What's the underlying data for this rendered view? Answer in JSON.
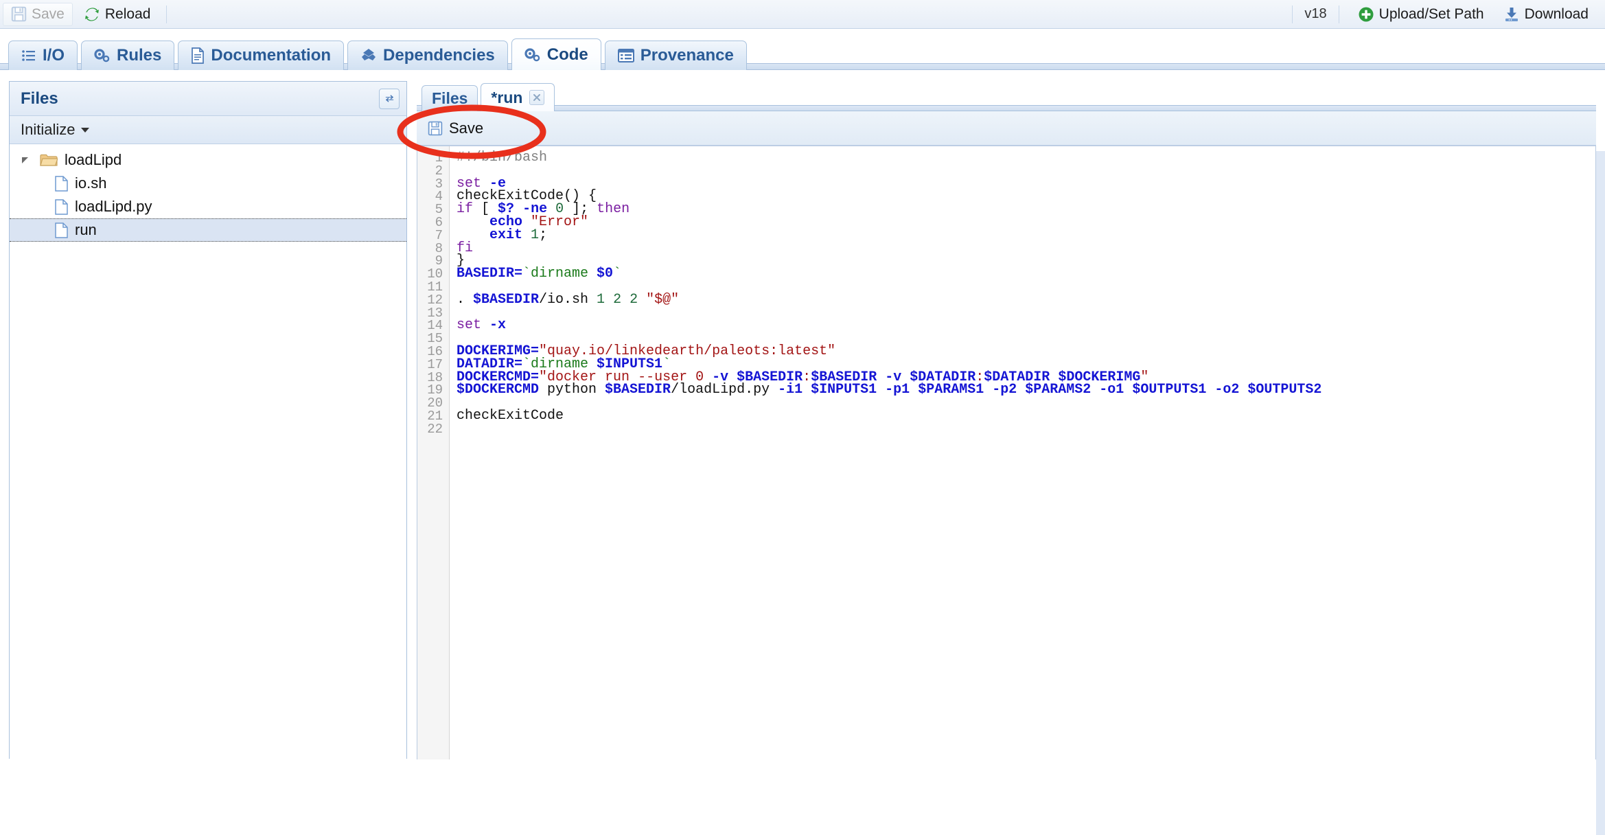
{
  "top_toolbar": {
    "save_label": "Save",
    "save_disabled": true,
    "reload_label": "Reload",
    "version_label": "v18",
    "upload_label": "Upload/Set Path",
    "download_label": "Download"
  },
  "main_tabs": [
    {
      "label": "I/O",
      "icon": "list-icon",
      "active": false
    },
    {
      "label": "Rules",
      "icon": "gears-icon",
      "active": false
    },
    {
      "label": "Documentation",
      "icon": "document-icon",
      "active": false
    },
    {
      "label": "Dependencies",
      "icon": "puzzle-icon",
      "active": false
    },
    {
      "label": "Code",
      "icon": "gears-icon",
      "active": true
    },
    {
      "label": "Provenance",
      "icon": "table-icon",
      "active": false
    }
  ],
  "files_panel": {
    "title": "Files",
    "refresh_icon": "refresh-icon",
    "initialize_label": "Initialize",
    "tree": [
      {
        "label": "loadLipd",
        "type": "folder",
        "level": 1,
        "expanded": true,
        "selected": false
      },
      {
        "label": "io.sh",
        "type": "file",
        "level": 2,
        "selected": false
      },
      {
        "label": "loadLipd.py",
        "type": "file",
        "level": 2,
        "selected": false
      },
      {
        "label": "run",
        "type": "file",
        "level": 2,
        "selected": true
      }
    ]
  },
  "editor": {
    "tabs": [
      {
        "label": "Files",
        "active": false,
        "closable": false
      },
      {
        "label": "*run",
        "active": true,
        "closable": true
      }
    ],
    "save_label": "Save",
    "first_line_number": 1,
    "last_line_number": 22,
    "lines": [
      {
        "n": 1,
        "tokens": [
          {
            "t": "#!/bin/bash",
            "c": "c"
          }
        ]
      },
      {
        "n": 2,
        "tokens": []
      },
      {
        "n": 3,
        "tokens": [
          {
            "t": "set",
            "c": "k"
          },
          {
            "t": " ",
            "c": "b"
          },
          {
            "t": "-e",
            "c": "v"
          }
        ]
      },
      {
        "n": 4,
        "tokens": [
          {
            "t": "checkExitCode() {",
            "c": "b"
          }
        ]
      },
      {
        "n": 5,
        "tokens": [
          {
            "t": "if",
            "c": "k"
          },
          {
            "t": " [ ",
            "c": "b"
          },
          {
            "t": "$?",
            "c": "v"
          },
          {
            "t": " ",
            "c": "b"
          },
          {
            "t": "-ne",
            "c": "v"
          },
          {
            "t": " ",
            "c": "b"
          },
          {
            "t": "0",
            "c": "n"
          },
          {
            "t": " ]; ",
            "c": "b"
          },
          {
            "t": "then",
            "c": "k"
          }
        ]
      },
      {
        "n": 6,
        "tokens": [
          {
            "t": "    ",
            "c": "b"
          },
          {
            "t": "echo",
            "c": "v"
          },
          {
            "t": " ",
            "c": "b"
          },
          {
            "t": "\"Error\"",
            "c": "s"
          }
        ]
      },
      {
        "n": 7,
        "tokens": [
          {
            "t": "    ",
            "c": "b"
          },
          {
            "t": "exit",
            "c": "v"
          },
          {
            "t": " ",
            "c": "b"
          },
          {
            "t": "1",
            "c": "n"
          },
          {
            "t": ";",
            "c": "b"
          }
        ]
      },
      {
        "n": 8,
        "tokens": [
          {
            "t": "fi",
            "c": "k"
          }
        ]
      },
      {
        "n": 9,
        "tokens": [
          {
            "t": "}",
            "c": "b"
          }
        ]
      },
      {
        "n": 10,
        "tokens": [
          {
            "t": "BASEDIR=",
            "c": "v"
          },
          {
            "t": "`dirname ",
            "c": "g"
          },
          {
            "t": "$0",
            "c": "v"
          },
          {
            "t": "`",
            "c": "g"
          }
        ]
      },
      {
        "n": 11,
        "tokens": []
      },
      {
        "n": 12,
        "tokens": [
          {
            "t": ". ",
            "c": "b"
          },
          {
            "t": "$BASEDIR",
            "c": "v"
          },
          {
            "t": "/io.sh ",
            "c": "b"
          },
          {
            "t": "1",
            "c": "n"
          },
          {
            "t": " ",
            "c": "b"
          },
          {
            "t": "2",
            "c": "n"
          },
          {
            "t": " ",
            "c": "b"
          },
          {
            "t": "2",
            "c": "n"
          },
          {
            "t": " ",
            "c": "b"
          },
          {
            "t": "\"$@\"",
            "c": "s"
          }
        ]
      },
      {
        "n": 13,
        "tokens": []
      },
      {
        "n": 14,
        "tokens": [
          {
            "t": "set",
            "c": "k"
          },
          {
            "t": " ",
            "c": "b"
          },
          {
            "t": "-x",
            "c": "v"
          }
        ]
      },
      {
        "n": 15,
        "tokens": []
      },
      {
        "n": 16,
        "tokens": [
          {
            "t": "DOCKERIMG=",
            "c": "v"
          },
          {
            "t": "\"quay.io/linkedearth/paleots:latest\"",
            "c": "s"
          }
        ]
      },
      {
        "n": 17,
        "tokens": [
          {
            "t": "DATADIR=",
            "c": "v"
          },
          {
            "t": "`dirname ",
            "c": "g"
          },
          {
            "t": "$INPUTS1",
            "c": "v"
          },
          {
            "t": "`",
            "c": "g"
          }
        ]
      },
      {
        "n": 18,
        "tokens": [
          {
            "t": "DOCKERCMD=",
            "c": "v"
          },
          {
            "t": "\"docker run ",
            "c": "s"
          },
          {
            "t": "--user",
            "c": "s"
          },
          {
            "t": " ",
            "c": "s"
          },
          {
            "t": "0",
            "c": "s"
          },
          {
            "t": " ",
            "c": "s"
          },
          {
            "t": "-v",
            "c": "v"
          },
          {
            "t": " ",
            "c": "b"
          },
          {
            "t": "$BASEDIR",
            "c": "v"
          },
          {
            "t": ":",
            "c": "s"
          },
          {
            "t": "$BASEDIR",
            "c": "v"
          },
          {
            "t": " ",
            "c": "b"
          },
          {
            "t": "-v",
            "c": "v"
          },
          {
            "t": " ",
            "c": "b"
          },
          {
            "t": "$DATADIR",
            "c": "v"
          },
          {
            "t": ":",
            "c": "s"
          },
          {
            "t": "$DATADIR",
            "c": "v"
          },
          {
            "t": " ",
            "c": "b"
          },
          {
            "t": "$DOCKERIMG",
            "c": "v"
          },
          {
            "t": "\"",
            "c": "s"
          }
        ]
      },
      {
        "n": 19,
        "tokens": [
          {
            "t": "$DOCKERCMD",
            "c": "v"
          },
          {
            "t": " python ",
            "c": "b"
          },
          {
            "t": "$BASEDIR",
            "c": "v"
          },
          {
            "t": "/loadLipd.py ",
            "c": "b"
          },
          {
            "t": "-i1",
            "c": "v"
          },
          {
            "t": " ",
            "c": "b"
          },
          {
            "t": "$INPUTS1",
            "c": "v"
          },
          {
            "t": " ",
            "c": "b"
          },
          {
            "t": "-p1",
            "c": "v"
          },
          {
            "t": " ",
            "c": "b"
          },
          {
            "t": "$PARAMS1",
            "c": "v"
          },
          {
            "t": " ",
            "c": "b"
          },
          {
            "t": "-p2",
            "c": "v"
          },
          {
            "t": " ",
            "c": "b"
          },
          {
            "t": "$PARAMS2",
            "c": "v"
          },
          {
            "t": " ",
            "c": "b"
          },
          {
            "t": "-o1",
            "c": "v"
          },
          {
            "t": " ",
            "c": "b"
          },
          {
            "t": "$OUTPUTS1",
            "c": "v"
          },
          {
            "t": " ",
            "c": "b"
          },
          {
            "t": "-o2",
            "c": "v"
          },
          {
            "t": " ",
            "c": "b"
          },
          {
            "t": "$OUTPUTS2",
            "c": "v"
          }
        ]
      },
      {
        "n": 20,
        "tokens": []
      },
      {
        "n": 21,
        "tokens": [
          {
            "t": "checkExitCode",
            "c": "b"
          }
        ]
      },
      {
        "n": 22,
        "tokens": []
      }
    ]
  },
  "annotation": {
    "shape": "ellipse",
    "color": "#e8301c",
    "targets": "Save"
  },
  "colors": {
    "accent": "#2a5b96",
    "chrome_border": "#a8c0dd",
    "selection": "#dae4f3",
    "annotation_red": "#e8301c",
    "code_keyword": "#7a1ea1",
    "code_variable": "#1414d4",
    "code_string": "#a31515",
    "code_subshell": "#1a7a1a",
    "code_number": "#1f6b3b",
    "code_comment": "#808080"
  }
}
